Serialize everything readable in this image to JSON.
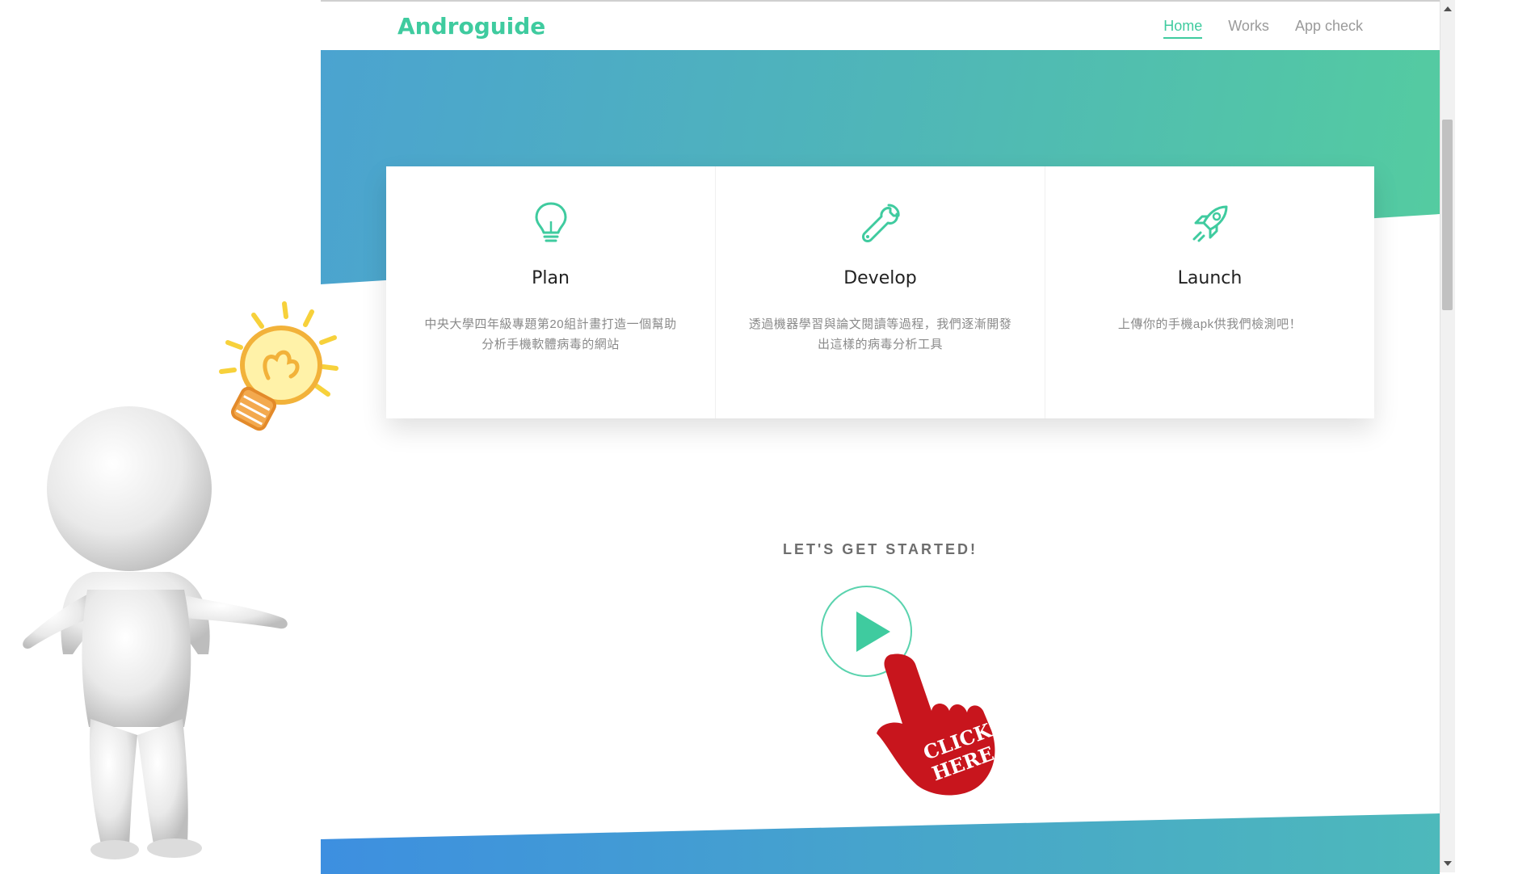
{
  "navbar": {
    "brand": "Androguide",
    "links": [
      {
        "label": "Home",
        "active": true
      },
      {
        "label": "Works",
        "active": false
      },
      {
        "label": "App check",
        "active": false
      }
    ]
  },
  "cards": [
    {
      "icon": "lightbulb-icon",
      "title": "Plan",
      "text": "中央大學四年級專題第20組計畫打造一個幫助分析手機軟體病毒的網站"
    },
    {
      "icon": "wrench-icon",
      "title": "Develop",
      "text": "透過機器學習與論文閱讀等過程，我們逐漸開發出這樣的病毒分析工具"
    },
    {
      "icon": "rocket-icon",
      "title": "Launch",
      "text": "上傳你的手機apk供我們檢測吧！"
    }
  ],
  "cta": {
    "title": "LET'S GET STARTED!",
    "icon": "play-icon"
  },
  "overlay": {
    "hand_text_line1": "CLICK",
    "hand_text_line2": "HERE"
  },
  "colors": {
    "accent": "#3fcb9f",
    "gradient_start": "#4ba3d0",
    "gradient_end": "#54cca0",
    "hand_red": "#c8151d"
  }
}
